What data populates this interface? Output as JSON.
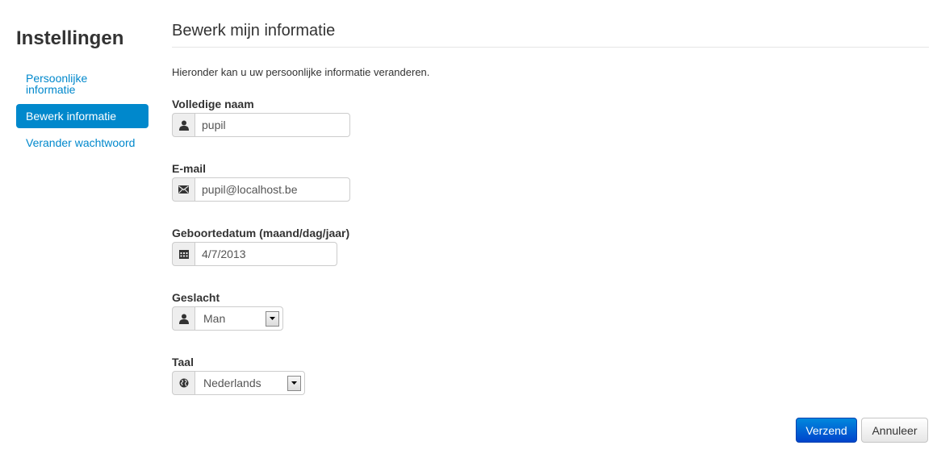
{
  "sidebar": {
    "title": "Instellingen",
    "items": [
      {
        "label": "Persoonlijke informatie",
        "active": false
      },
      {
        "label": "Bewerk informatie",
        "active": true
      },
      {
        "label": "Verander wachtwoord",
        "active": false
      }
    ]
  },
  "main": {
    "title": "Bewerk mijn informatie",
    "intro": "Hieronder kan u uw persoonlijke informatie veranderen.",
    "fields": {
      "name": {
        "label": "Volledige naam",
        "value": "pupil",
        "icon": "user-icon"
      },
      "email": {
        "label": "E-mail",
        "value": "pupil@localhost.be",
        "icon": "envelope-icon"
      },
      "birthdate": {
        "label": "Geboortedatum (maand/dag/jaar)",
        "value": "4/7/2013",
        "icon": "calendar-icon"
      },
      "gender": {
        "label": "Geslacht",
        "value": "Man",
        "icon": "user-icon"
      },
      "language": {
        "label": "Taal",
        "value": "Nederlands",
        "icon": "globe-icon"
      }
    },
    "buttons": {
      "submit": "Verzend",
      "cancel": "Annuleer"
    }
  },
  "colors": {
    "accent": "#0088cc",
    "primary_button": "#0055cc"
  }
}
